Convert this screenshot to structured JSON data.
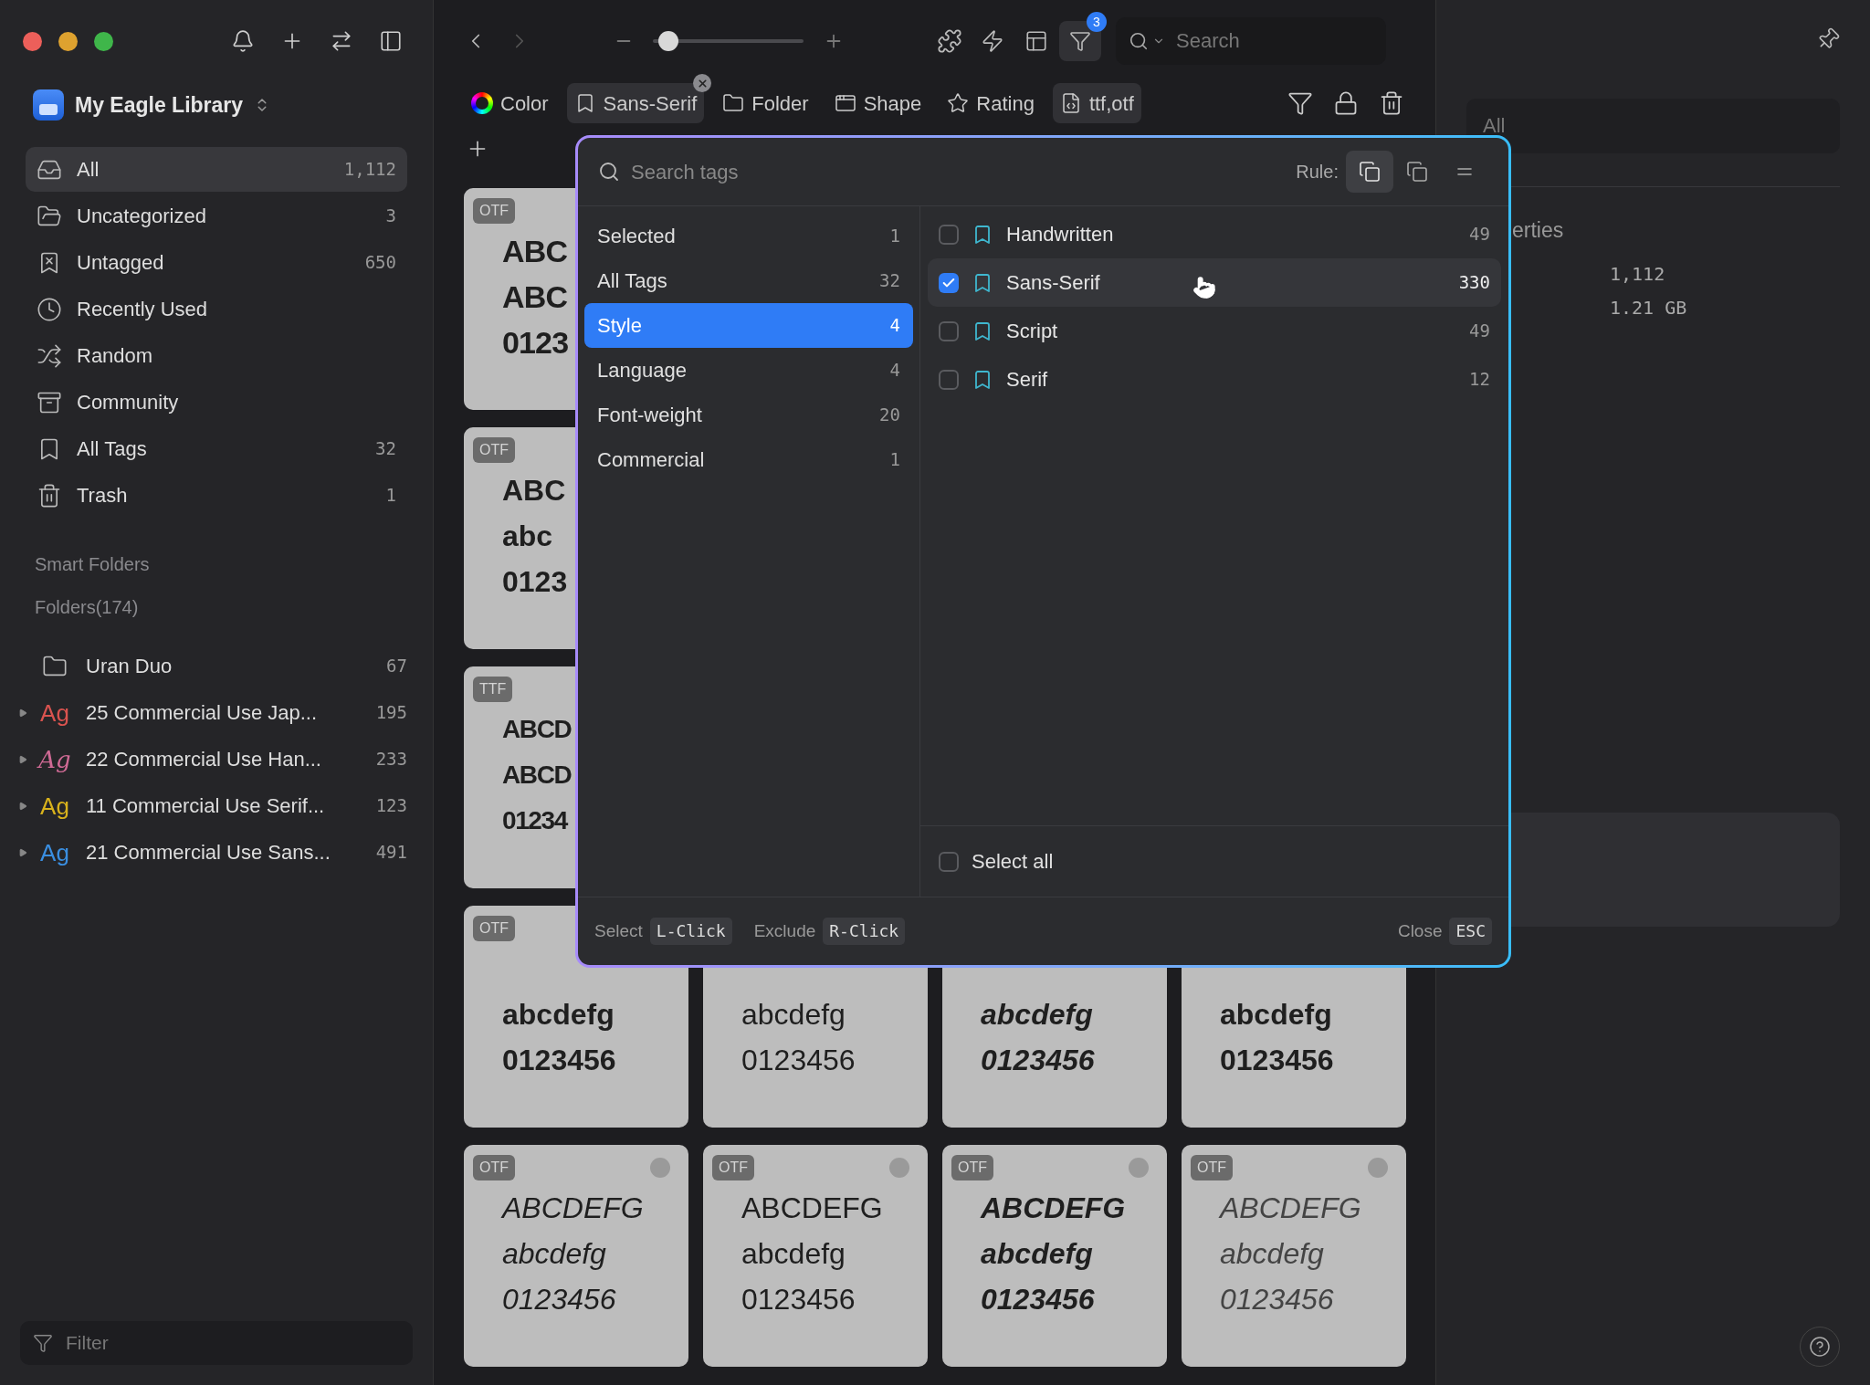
{
  "window": {
    "traffic_lights": [
      {
        "color": "#ec5f5a"
      },
      {
        "color": "#dea22f"
      },
      {
        "color": "#3fb64a"
      }
    ]
  },
  "sidebar": {
    "library": "My Eagle Library",
    "nav": [
      {
        "label": "All",
        "count": "1,112",
        "selected": true
      },
      {
        "label": "Uncategorized",
        "count": "3",
        "selected": false
      },
      {
        "label": "Untagged",
        "count": "650",
        "selected": false
      },
      {
        "label": "Recently Used",
        "selected": false
      },
      {
        "label": "Random",
        "selected": false
      },
      {
        "label": "Community",
        "selected": false
      },
      {
        "label": "All Tags",
        "count": "32",
        "selected": false
      },
      {
        "label": "Trash",
        "count": "1",
        "selected": false
      }
    ],
    "sections": [
      "Smart Folders",
      "Folders(174)"
    ],
    "folders": [
      {
        "kind": "folder",
        "label": "Uran Duo",
        "count": "67",
        "expandable": false
      },
      {
        "kind": "font",
        "ag": "Ag",
        "color": "#d9534f",
        "label": "25 Commercial Use Jap...",
        "count": "195",
        "expandable": true
      },
      {
        "kind": "script",
        "ag": "Ag",
        "color": "#d06a95",
        "label": "22 Commercial Use Han...",
        "count": "233",
        "expandable": true
      },
      {
        "kind": "font",
        "ag": "Ag",
        "color": "#d8b21c",
        "label": "11 Commercial Use Serif...",
        "count": "123",
        "expandable": true
      },
      {
        "kind": "font",
        "ag": "Ag",
        "color": "#3a8ee0",
        "label": "21 Commercial Use Sans...",
        "count": "491",
        "expandable": true
      }
    ],
    "filter": {
      "placeholder": "Filter"
    }
  },
  "toolbar": {
    "zoom": {
      "level": 0.1
    },
    "filter_badge": "3",
    "search": {
      "placeholder": "Search"
    }
  },
  "filters": [
    {
      "label": "Color",
      "active": false,
      "closable": false
    },
    {
      "label": "Sans-Serif",
      "active": true,
      "closable": true
    },
    {
      "label": "Folder",
      "active": false,
      "closable": false
    },
    {
      "label": "Shape",
      "active": false,
      "closable": false
    },
    {
      "label": "Rating",
      "active": false,
      "closable": false
    },
    {
      "label": "ttf,otf",
      "active": true,
      "closable": false
    }
  ],
  "grid": [
    {
      "cards": [
        {
          "badge": "OTF",
          "kind": "black",
          "lines": [
            "ABC",
            "ABC",
            "0123"
          ]
        }
      ]
    },
    {
      "cards": [
        {
          "badge": "OTF",
          "kind": "bold",
          "lines": [
            "ABC",
            "abc",
            "0123"
          ]
        }
      ]
    },
    {
      "cards": [
        {
          "badge": "TTF",
          "kind": "condensed",
          "lines": [
            "ABCD",
            "ABCD",
            "01234"
          ]
        }
      ]
    },
    {
      "cards": [
        {
          "badge": "OTF",
          "kind": "bold",
          "lines": [
            "abcdefg",
            "0123456"
          ]
        },
        {
          "kind": "regular",
          "lines": [
            "abcdefg",
            "0123456"
          ]
        },
        {
          "kind": "bolditalic",
          "lines": [
            "abcdefg",
            "0123456"
          ]
        },
        {
          "kind": "semibold",
          "lines": [
            "abcdefg",
            "0123456"
          ]
        }
      ]
    },
    {
      "cards": [
        {
          "badge": "OTF",
          "kind": "italic",
          "dot": true,
          "lines": [
            "ABCDEFG",
            "abcdefg",
            "0123456"
          ]
        },
        {
          "badge": "OTF",
          "kind": "regular",
          "dot": true,
          "lines": [
            "ABCDEFG",
            "abcdefg",
            "0123456"
          ]
        },
        {
          "badge": "OTF",
          "kind": "bolditalic",
          "dot": true,
          "lines": [
            "ABCDEFG",
            "abcdefg",
            "0123456"
          ]
        },
        {
          "badge": "OTF",
          "kind": "lightitalic",
          "dot": true,
          "lines": [
            "ABCDEFG",
            "abcdefg",
            "0123456"
          ]
        }
      ]
    }
  ],
  "tag_popup": {
    "search": {
      "placeholder": "Search tags"
    },
    "rule_label": "Rule:",
    "rule_options": [
      {
        "selected": true
      },
      {
        "selected": false
      },
      {
        "selected": false
      }
    ],
    "groups": [
      {
        "label": "Selected",
        "count": "1",
        "selected": false
      },
      {
        "label": "All Tags",
        "count": "32",
        "selected": false
      },
      {
        "label": "Style",
        "count": "4",
        "selected": true
      },
      {
        "label": "Language",
        "count": "4",
        "selected": false
      },
      {
        "label": "Font-weight",
        "count": "20",
        "selected": false
      },
      {
        "label": "Commercial",
        "count": "1",
        "selected": false
      }
    ],
    "tags": [
      {
        "label": "Handwritten",
        "count": "49",
        "checked": false,
        "highlighted": false
      },
      {
        "label": "Sans-Serif",
        "count": "330",
        "checked": true,
        "highlighted": true
      },
      {
        "label": "Script",
        "count": "49",
        "checked": false,
        "highlighted": false
      },
      {
        "label": "Serif",
        "count": "12",
        "checked": false,
        "highlighted": false
      }
    ],
    "select_all": {
      "label": "Select all",
      "checked": false
    },
    "hints": [
      {
        "action": "Select",
        "key": "L-Click"
      },
      {
        "action": "Exclude",
        "key": "R-Click"
      }
    ],
    "close": {
      "action": "Close",
      "key": "ESC"
    }
  },
  "right_panel": {
    "search": {
      "value": "All"
    },
    "section_title": "erties",
    "values": [
      "1,112",
      "1.21 GB"
    ]
  }
}
